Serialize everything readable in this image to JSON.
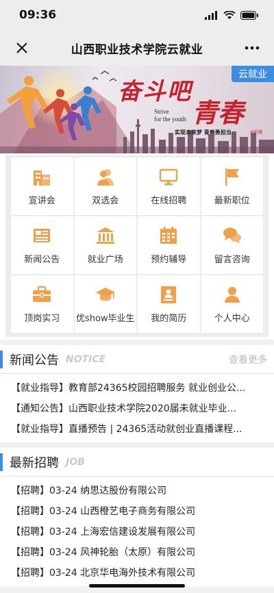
{
  "status": {
    "time": "09:36"
  },
  "nav": {
    "title": "山西职业技术学院云就业"
  },
  "banner": {
    "badge": "云就业",
    "slogan_a": "奋斗吧",
    "slogan_b": "青春",
    "english": "Strive\nfor the youth",
    "motto": "实现未来梦  青春勇担当",
    "signature": "出彩路"
  },
  "grid": [
    {
      "label": "宣讲会",
      "icon": "building-icon"
    },
    {
      "label": "双选会",
      "icon": "users-icon"
    },
    {
      "label": "在线招聘",
      "icon": "monitor-icon"
    },
    {
      "label": "最新职位",
      "icon": "flag-icon"
    },
    {
      "label": "新闻公告",
      "icon": "newspaper-icon"
    },
    {
      "label": "就业广场",
      "icon": "bank-icon"
    },
    {
      "label": "预约辅导",
      "icon": "calendar-icon"
    },
    {
      "label": "留言咨询",
      "icon": "chat-icon"
    },
    {
      "label": "顶岗实习",
      "icon": "briefcase-icon"
    },
    {
      "label": "优show毕业生",
      "icon": "graduation-cap-icon"
    },
    {
      "label": "我的简历",
      "icon": "resume-icon"
    },
    {
      "label": "个人中心",
      "icon": "person-icon"
    }
  ],
  "news": {
    "title": "新闻公告",
    "title_en": "NOTICE",
    "more": "查看更多",
    "items": [
      "【就业指导】教育部24365校园招聘服务 就业创业公...",
      "【通知公告】山西职业技术学院2020届未就业毕业...",
      "【就业指导】直播预告 | 24365活动就创业直播课程..."
    ]
  },
  "jobs": {
    "title": "最新招聘",
    "title_en": "JOB",
    "items": [
      "【招聘】03-24 纳思达股份有限公司",
      "【招聘】03-24 山西橙艺电子商务有限公司",
      "【招聘】03-24 上海宏信建设发展有限公司",
      "【招聘】03-24 风神轮胎（太原）有限公司",
      "【招聘】03-24 北京华电海外技术有限公司"
    ]
  },
  "colors": {
    "accent": "#3d8de0",
    "icon": "#f0a04b",
    "slogan": "#c4222f"
  }
}
